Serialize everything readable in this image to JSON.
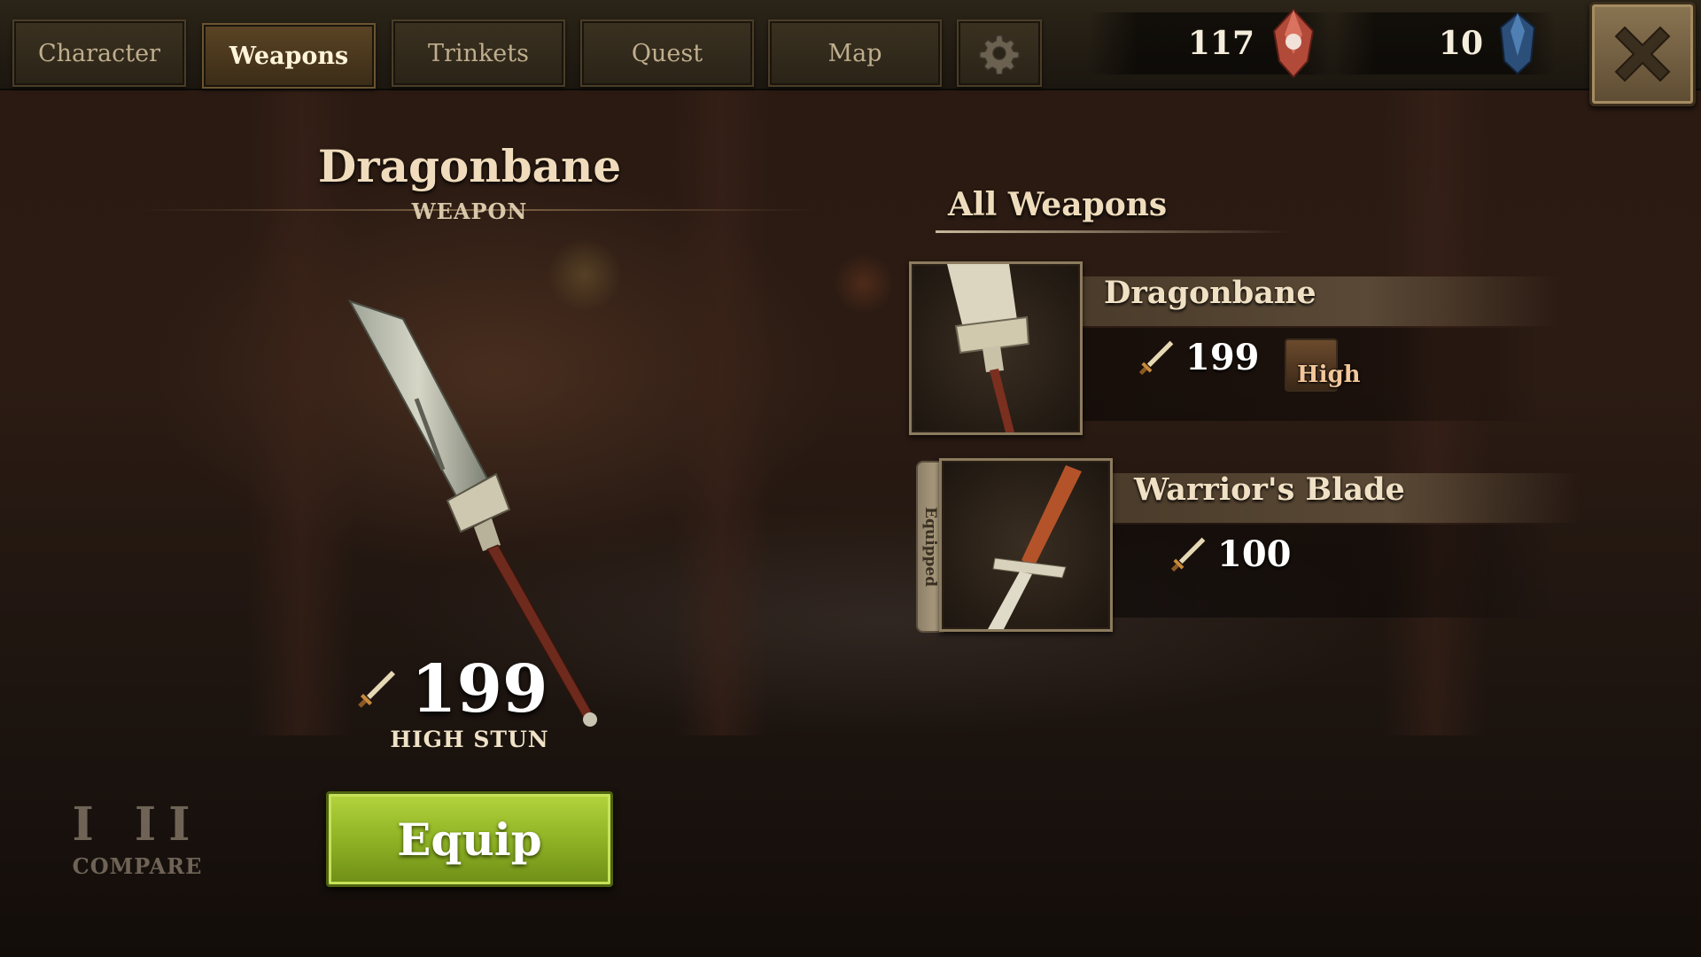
{
  "tabs": [
    "Character",
    "Weapons",
    "Trinkets",
    "Quest",
    "Map"
  ],
  "active_tab": "Weapons",
  "currency": {
    "red_gems": "117",
    "blue_gems": "10"
  },
  "selected_item": {
    "name": "Dragonbane",
    "type": "WEAPON",
    "damage": "199",
    "stun": "HIGH STUN"
  },
  "compare": {
    "numerals": "I II",
    "label": "COMPARE"
  },
  "equip_label": "Equip",
  "list": {
    "title": "All Weapons",
    "items": [
      {
        "name": "Dragonbane",
        "damage": "199",
        "stun": "High",
        "equipped": false
      },
      {
        "name": "Warrior's Blade",
        "damage": "100",
        "stun": "",
        "equipped": true,
        "equipped_label": "Equipped"
      }
    ]
  },
  "icons": {
    "settings": "gear-icon",
    "close": "close-icon",
    "damage": "sword-icon",
    "red_currency": "red-gem-icon",
    "blue_currency": "blue-gem-icon"
  },
  "colors": {
    "equip_button": "#8fb325",
    "panel_banner": "#5a4936"
  }
}
